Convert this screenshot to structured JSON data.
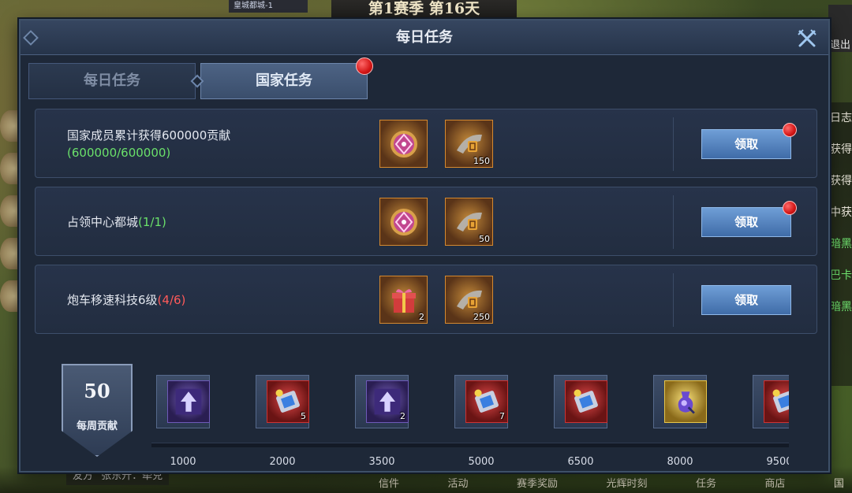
{
  "background": {
    "top_label": "皇城都城-1",
    "season_banner": "第1赛季 第16天",
    "exit_label": "退出",
    "right_strip": [
      {
        "text": "日志",
        "color": "white"
      },
      {
        "text": "获得",
        "color": "white"
      },
      {
        "text": "获得",
        "color": "white"
      },
      {
        "text": "中获",
        "color": "white"
      },
      {
        "text": "暗黑",
        "color": "green"
      },
      {
        "text": "巴卡",
        "color": "green"
      },
      {
        "text": "暗黑",
        "color": "green"
      }
    ],
    "bottom_status": {
      "tag": "友方",
      "text": "张东升：牵兑"
    },
    "bottom_nav": [
      "信件",
      "活动",
      "赛季奖励",
      "光辉时刻",
      "任务",
      "商店",
      "国"
    ]
  },
  "dialog": {
    "title": "每日任务",
    "close_icon": "close-x-icon",
    "tabs": [
      {
        "label": "每日任务",
        "active": false,
        "has_notice": false
      },
      {
        "label": "国家任务",
        "active": true,
        "has_notice": true
      }
    ],
    "tasks": [
      {
        "description": "国家成员累计获得600000贡献",
        "progress": "(600000/600000)",
        "progress_state": "complete",
        "rewards": [
          {
            "icon": "pink-rune-orb-icon",
            "rarity": "orange",
            "count": ""
          },
          {
            "icon": "war-horn-icon",
            "rarity": "orange",
            "count": "150"
          }
        ],
        "button_label": "领取",
        "button_notice": true
      },
      {
        "description": "占领中心都城",
        "progress": "(1/1)",
        "progress_state": "complete",
        "rewards": [
          {
            "icon": "pink-rune-orb-icon",
            "rarity": "orange",
            "count": ""
          },
          {
            "icon": "war-horn-icon",
            "rarity": "orange",
            "count": "50"
          }
        ],
        "button_label": "领取",
        "button_notice": true
      },
      {
        "description": "炮车移速科技6级",
        "progress": "(4/6)",
        "progress_state": "incomplete",
        "rewards": [
          {
            "icon": "gift-box-icon",
            "rarity": "orange",
            "count": "2"
          },
          {
            "icon": "war-horn-icon",
            "rarity": "orange",
            "count": "250"
          }
        ],
        "button_label": "领取",
        "button_notice": false
      }
    ],
    "weekly": {
      "value": "50",
      "label": "每周贡献",
      "milestones": [
        {
          "threshold": "1000",
          "icon": "upgrade-arrow-icon",
          "rarity": "purple",
          "count": ""
        },
        {
          "threshold": "2000",
          "icon": "blue-gem-scroll-icon",
          "rarity": "red",
          "count": "5"
        },
        {
          "threshold": "3500",
          "icon": "upgrade-arrow-icon",
          "rarity": "purple",
          "count": "2"
        },
        {
          "threshold": "5000",
          "icon": "blue-gem-scroll-icon",
          "rarity": "red",
          "count": "7"
        },
        {
          "threshold": "6500",
          "icon": "blue-gem-scroll-icon",
          "rarity": "red",
          "count": ""
        },
        {
          "threshold": "8000",
          "icon": "purple-potion-icon",
          "rarity": "gold",
          "count": ""
        },
        {
          "threshold": "9500",
          "icon": "blue-gem-scroll-icon",
          "rarity": "red",
          "count": ""
        }
      ]
    }
  },
  "colors": {
    "progress_complete": "#6ae06a",
    "progress_incomplete": "#ff5a5a",
    "button": "#4f7fbd",
    "notice": "#e01b1b"
  }
}
